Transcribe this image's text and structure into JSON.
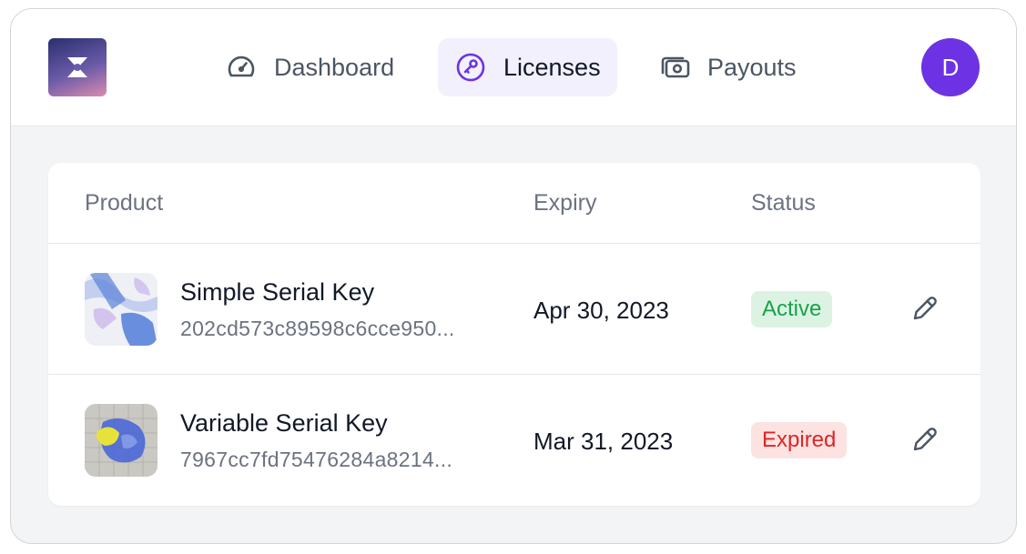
{
  "nav": {
    "items": [
      {
        "label": "Dashboard",
        "icon": "gauge-icon"
      },
      {
        "label": "Licenses",
        "icon": "key-icon",
        "active": true
      },
      {
        "label": "Payouts",
        "icon": "cash-icon"
      }
    ]
  },
  "user": {
    "avatar_initial": "D"
  },
  "table": {
    "headers": {
      "product": "Product",
      "expiry": "Expiry",
      "status": "Status"
    },
    "rows": [
      {
        "name": "Simple Serial Key",
        "key": "202cd573c89598c6cce950...",
        "expiry": "Apr 30, 2023",
        "status": "Active"
      },
      {
        "name": "Variable Serial Key",
        "key": "7967cc7fd75476284a8214...",
        "expiry": "Mar 31, 2023",
        "status": "Expired"
      }
    ]
  },
  "colors": {
    "accent": "#6d32e3",
    "active_nav_bg": "#f1f0fc",
    "status_active_bg": "#dcf3e4",
    "status_active_text": "#16a34a",
    "status_expired_bg": "#fde2e2",
    "status_expired_text": "#dc2626"
  }
}
